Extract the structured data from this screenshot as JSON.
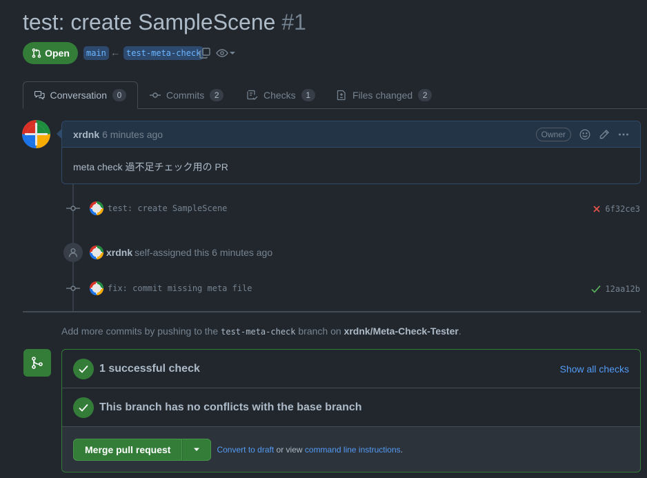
{
  "pr": {
    "title": "test: create SampleScene",
    "number": "#1",
    "state": "Open",
    "base_branch": "main",
    "head_branch": "test-meta-check"
  },
  "tabs": [
    {
      "label": "Conversation",
      "count": "0",
      "icon": "comment-discussion-icon"
    },
    {
      "label": "Commits",
      "count": "2",
      "icon": "git-commit-icon"
    },
    {
      "label": "Checks",
      "count": "1",
      "icon": "checklist-icon"
    },
    {
      "label": "Files changed",
      "count": "2",
      "icon": "file-diff-icon"
    }
  ],
  "comment": {
    "author": "xrdnk",
    "time": "6 minutes ago",
    "role": "Owner",
    "body": "meta check 過不足チェック用の PR"
  },
  "timeline": {
    "commit1": {
      "message": "test: create SampleScene",
      "sha": "6f32ce3",
      "status": "failure"
    },
    "event": {
      "actor": "xrdnk",
      "text": "self-assigned this 6 minutes ago"
    },
    "commit2": {
      "message": "fix: commit missing meta file",
      "sha": "12aa12b",
      "status": "success"
    }
  },
  "info": {
    "prefix": "Add more commits by pushing to the",
    "branch": "test-meta-check",
    "middle": "branch on",
    "repo": "xrdnk/Meta-Check-Tester",
    "suffix": "."
  },
  "merge": {
    "checks_label": "1 successful check",
    "show_all": "Show all checks",
    "conflicts_label": "This branch has no conflicts with the base branch",
    "merge_button": "Merge pull request",
    "convert_link": "Convert to draft",
    "or_view": "or view",
    "cli_link": "command line instructions",
    "period": "."
  },
  "colors": {
    "open_green": "#347d39",
    "link_blue": "#539bf5",
    "fail_red": "#e5534b",
    "success_green": "#57ab5a"
  }
}
